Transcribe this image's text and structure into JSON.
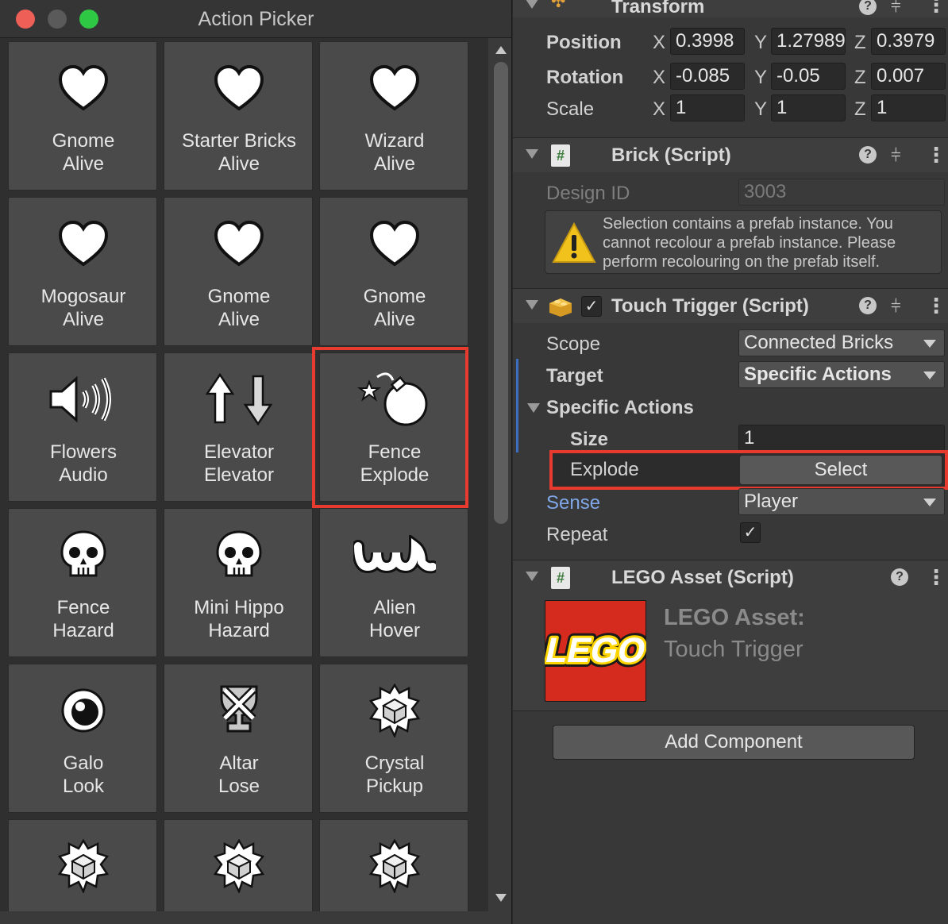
{
  "picker": {
    "title": "Action Picker",
    "cells": [
      {
        "icon": "heart-icon",
        "line1": "Gnome",
        "line2": "Alive"
      },
      {
        "icon": "heart-icon",
        "line1": "Starter Bricks",
        "line2": "Alive"
      },
      {
        "icon": "heart-icon",
        "line1": "Wizard",
        "line2": "Alive"
      },
      {
        "icon": "heart-icon",
        "line1": "Mogosaur",
        "line2": "Alive"
      },
      {
        "icon": "heart-icon",
        "line1": "Gnome",
        "line2": "Alive"
      },
      {
        "icon": "heart-icon",
        "line1": "Gnome",
        "line2": "Alive"
      },
      {
        "icon": "speaker-icon",
        "line1": "Flowers",
        "line2": "Audio"
      },
      {
        "icon": "up-down-arrows-icon",
        "line1": "Elevator",
        "line2": "Elevator"
      },
      {
        "icon": "bomb-icon",
        "line1": "Fence",
        "line2": "Explode"
      },
      {
        "icon": "skull-icon",
        "line1": "Fence",
        "line2": "Hazard"
      },
      {
        "icon": "skull-icon",
        "line1": "Mini Hippo",
        "line2": "Hazard"
      },
      {
        "icon": "wave-icon",
        "line1": "Alien",
        "line2": "Hover"
      },
      {
        "icon": "eye-icon",
        "line1": "Galo",
        "line2": "Look"
      },
      {
        "icon": "trophy-x-icon",
        "line1": "Altar",
        "line2": "Lose"
      },
      {
        "icon": "crystal-pickup-icon",
        "line1": "Crystal",
        "line2": "Pickup"
      },
      {
        "icon": "crystal-pickup-icon",
        "line1": "",
        "line2": ""
      },
      {
        "icon": "crystal-pickup-icon",
        "line1": "",
        "line2": ""
      },
      {
        "icon": "crystal-pickup-icon",
        "line1": "",
        "line2": ""
      }
    ]
  },
  "transform": {
    "title": "Transform",
    "position": {
      "label": "Position",
      "x": "0.3998",
      "y": "1.27989",
      "z": "0.3979"
    },
    "rotation": {
      "label": "Rotation",
      "x": "-0.085",
      "y": "-0.05",
      "z": "0.007"
    },
    "scale": {
      "label": "Scale",
      "x": "1",
      "y": "1",
      "z": "1"
    },
    "axis_x": "X",
    "axis_y": "Y",
    "axis_z": "Z"
  },
  "brick": {
    "title": "Brick (Script)",
    "design_id_label": "Design ID",
    "design_id_value": "3003",
    "warning": "Selection contains a prefab instance. You cannot recolour a prefab instance. Please perform recolouring on the prefab itself."
  },
  "touch_trigger": {
    "title": "Touch Trigger (Script)",
    "scope_label": "Scope",
    "scope_value": "Connected Bricks",
    "target_label": "Target",
    "target_value": "Specific Actions",
    "specific_actions_label": "Specific Actions",
    "size_label": "Size",
    "size_value": "1",
    "element_label": "Explode",
    "element_button": "Select",
    "sense_label": "Sense",
    "sense_value": "Player",
    "repeat_label": "Repeat",
    "repeat_checked": true
  },
  "lego_asset": {
    "title": "LEGO Asset (Script)",
    "logo_text": "LEGO",
    "heading": "LEGO Asset:",
    "subheading": "Touch Trigger"
  },
  "add_component_label": "Add Component",
  "colors": {
    "highlight": "#e63b2e",
    "lego_red": "#d52b1e",
    "lego_yellow": "#ffd500"
  }
}
